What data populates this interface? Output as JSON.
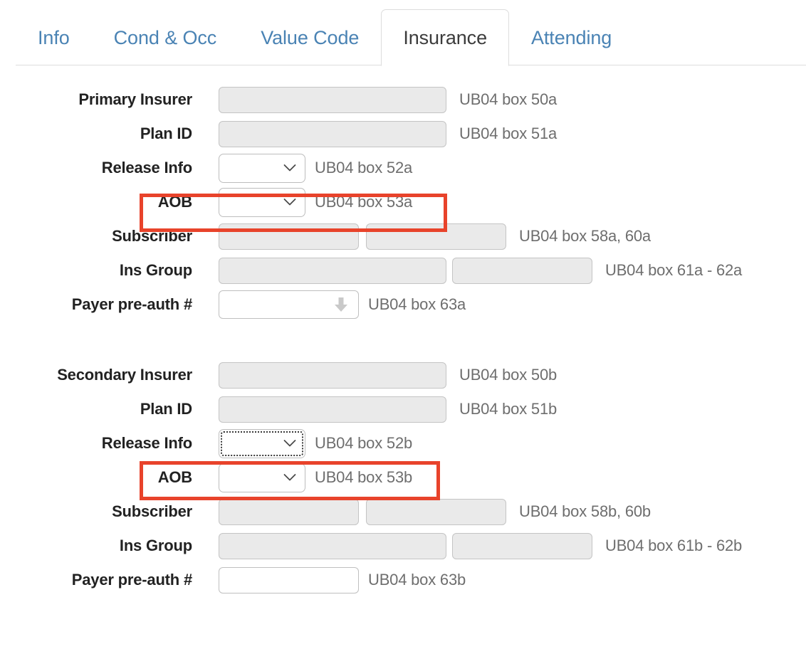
{
  "tabs": [
    {
      "label": "Info",
      "active": false
    },
    {
      "label": "Cond & Occ",
      "active": false
    },
    {
      "label": "Value Code",
      "active": false
    },
    {
      "label": "Insurance",
      "active": true
    },
    {
      "label": "Attending",
      "active": false
    }
  ],
  "primary": {
    "rows": [
      {
        "label": "Primary Insurer",
        "helper": "UB04 box 50a"
      },
      {
        "label": "Plan ID",
        "helper": "UB04 box 51a"
      },
      {
        "label": "Release Info",
        "helper": "UB04 box 52a"
      },
      {
        "label": "AOB",
        "helper": "UB04 box 53a"
      },
      {
        "label": "Subscriber",
        "helper": "UB04 box 58a, 60a"
      },
      {
        "label": "Ins Group",
        "helper": "UB04 box 61a - 62a"
      },
      {
        "label": "Payer pre-auth #",
        "helper": "UB04 box 63a"
      }
    ],
    "values": {
      "primary_insurer": "",
      "plan_id": "",
      "release_info": "",
      "aob": "",
      "subscriber_1": "",
      "subscriber_2": "",
      "ins_group_1": "",
      "ins_group_2": "",
      "payer_preauth": ""
    }
  },
  "secondary": {
    "rows": [
      {
        "label": "Secondary Insurer",
        "helper": "UB04 box 50b"
      },
      {
        "label": "Plan ID",
        "helper": "UB04 box 51b"
      },
      {
        "label": "Release Info",
        "helper": "UB04 box 52b"
      },
      {
        "label": "AOB",
        "helper": "UB04 box 53b"
      },
      {
        "label": "Subscriber",
        "helper": "UB04 box 58b, 60b"
      },
      {
        "label": "Ins Group",
        "helper": "UB04 box 61b - 62b"
      },
      {
        "label": "Payer pre-auth #",
        "helper": "UB04 box 63b"
      }
    ],
    "values": {
      "secondary_insurer": "",
      "plan_id": "",
      "release_info": "",
      "aob": "",
      "subscriber_1": "",
      "subscriber_2": "",
      "ins_group_1": "",
      "ins_group_2": "",
      "payer_preauth": ""
    }
  },
  "colors": {
    "tab_link": "#4a83b4",
    "tab_active_text": "#3c3c3c",
    "label_text": "#222222",
    "helper_text": "#6e6e6e",
    "disabled_field": "#eaeaea",
    "field_border": "#bfbfbf",
    "annotation_red": "#e8432b"
  },
  "annotations": [
    {
      "name": "aob-primary-highlight",
      "target": "AOB row (UB04 box 53a)"
    },
    {
      "name": "aob-secondary-highlight",
      "target": "AOB row (UB04 box 53b)"
    }
  ]
}
